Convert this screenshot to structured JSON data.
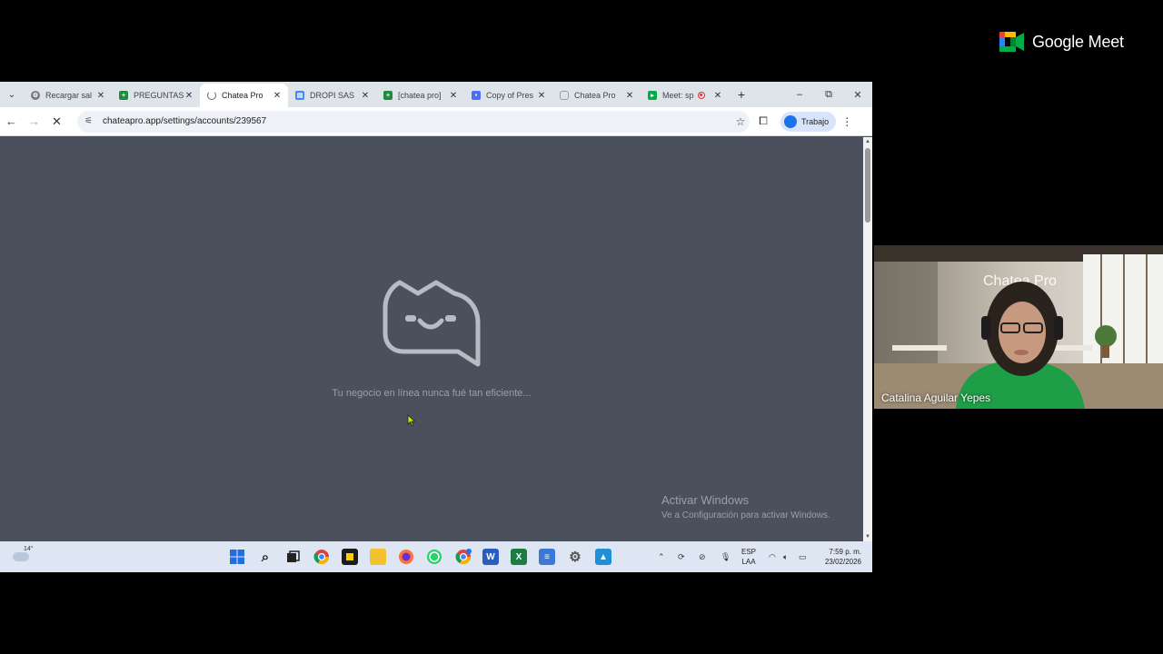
{
  "meet": {
    "app_name": "Google Meet",
    "participant_name": "Catalina Aguilar Yepes",
    "background_sign": "Chatea Pro"
  },
  "browser": {
    "tabs": [
      {
        "label": "Recargar sal",
        "icon": "gear-favicon",
        "color": "#666666",
        "active": false
      },
      {
        "label": "PREGUNTAS",
        "icon": "sheets-favicon",
        "color": "#1e8e3e",
        "active": false
      },
      {
        "label": "Chatea Pro",
        "icon": "loading-spinner",
        "color": "#5f6368",
        "active": true
      },
      {
        "label": "DROPI SAS",
        "icon": "docs-favicon",
        "color": "#4285f4",
        "active": false
      },
      {
        "label": "[chatea pro]",
        "icon": "sheets-favicon",
        "color": "#1e8e3e",
        "active": false
      },
      {
        "label": "Copy of Pres",
        "icon": "chat-favicon",
        "color": "#4c6ef5",
        "active": false
      },
      {
        "label": "Chatea Pro",
        "icon": "chat-favicon",
        "color": "#9aa0a6",
        "active": false
      },
      {
        "label": "Meet: sp",
        "icon": "meet-favicon",
        "color": "#00ac47",
        "active": false
      }
    ],
    "url": "chateapro.app/settings/accounts/239567",
    "profile_label": "Trabajo"
  },
  "page": {
    "tagline": "Tu negocio en línea nunca fué tan eficiente..."
  },
  "watermark": {
    "title": "Activar Windows",
    "subtitle": "Ve a Configuración para activar Windows."
  },
  "taskbar": {
    "temperature": "14°",
    "language_line1": "ESP",
    "language_line2": "LAA",
    "time": "7:59 p. m.",
    "date": "23/02/2026"
  }
}
